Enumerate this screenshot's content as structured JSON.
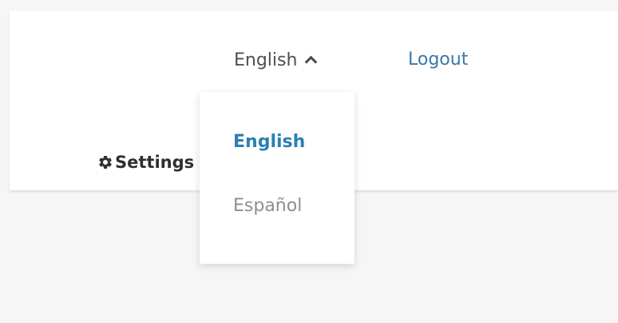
{
  "header": {
    "language_selector": {
      "current_label": "English",
      "chevron_icon": "chevron-up-icon"
    },
    "logout_label": "Logout",
    "settings_label": "Settings",
    "settings_icon": "gear-icon"
  },
  "language_menu": {
    "items": [
      {
        "label": "English",
        "selected": true
      },
      {
        "label": "Español",
        "selected": false
      }
    ]
  },
  "colors": {
    "accent": "#2b7fb4",
    "link": "#3a78a8",
    "text": "#4f4f4f",
    "muted": "#8e8e8e",
    "background": "#f6f6f6"
  }
}
